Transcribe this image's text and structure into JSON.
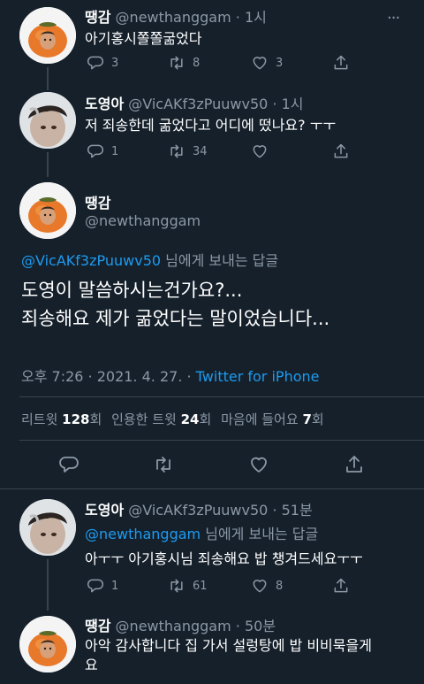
{
  "tweet1": {
    "name": "땡감",
    "handle": "@newthanggam",
    "time": "· 1시",
    "text": "아기홍시쫄쫄굶었다",
    "replies": "3",
    "retweets": "8",
    "likes": "3"
  },
  "tweet2": {
    "name": "도영아",
    "handle": "@VicAKf3zPuuwv50",
    "time": "· 1시",
    "text": "저 죄송한데 굶었다고 어디에 떴나요? ㅜㅜ",
    "replies": "1",
    "retweets": "34",
    "likes": ""
  },
  "main": {
    "name": "땡감",
    "handle": "@newthanggam",
    "reply_to_handle": "@VicAKf3zPuuwv50",
    "reply_to_suffix": " 님에게 보내는 답글",
    "text_line1": "도영이 말씀하시는건가요?...",
    "text_line2": "죄송해요 제가 굶었다는 말이었습니다...",
    "timestamp": "오후 7:26 · 2021. 4. 27. · ",
    "source": "Twitter for iPhone",
    "stats": {
      "retweet_label": "리트윗 ",
      "retweet_count": "128",
      "retweet_unit": "회",
      "quote_label": "인용한 트윗 ",
      "quote_count": "24",
      "quote_unit": "회",
      "like_label": "마음에 들어요 ",
      "like_count": "7",
      "like_unit": "회"
    }
  },
  "reply1": {
    "name": "도영아",
    "handle": "@VicAKf3zPuuwv50",
    "time": "· 51분",
    "reply_to_handle": "@newthanggam",
    "reply_to_suffix": " 님에게 보내는 답글",
    "text": "아ㅜㅜ 아기홍시님 죄송해요 밥 챙겨드세요ㅜㅜ",
    "replies": "1",
    "retweets": "61",
    "likes": "8"
  },
  "reply2": {
    "name": "땡감",
    "handle": "@newthanggam",
    "time": "· 50분",
    "text_line1": "아악 감사합니다 집 가서 설렁탕에 밥 비비묵을게",
    "text_line2": "요"
  },
  "icons": {
    "reply": "reply-icon",
    "retweet": "retweet-icon",
    "like": "heart-icon",
    "share": "share-icon",
    "more": "more-icon"
  },
  "colors": {
    "background": "#15202b",
    "accent": "#1d9bf0",
    "muted": "#8b98a5",
    "divider": "#38444d"
  }
}
